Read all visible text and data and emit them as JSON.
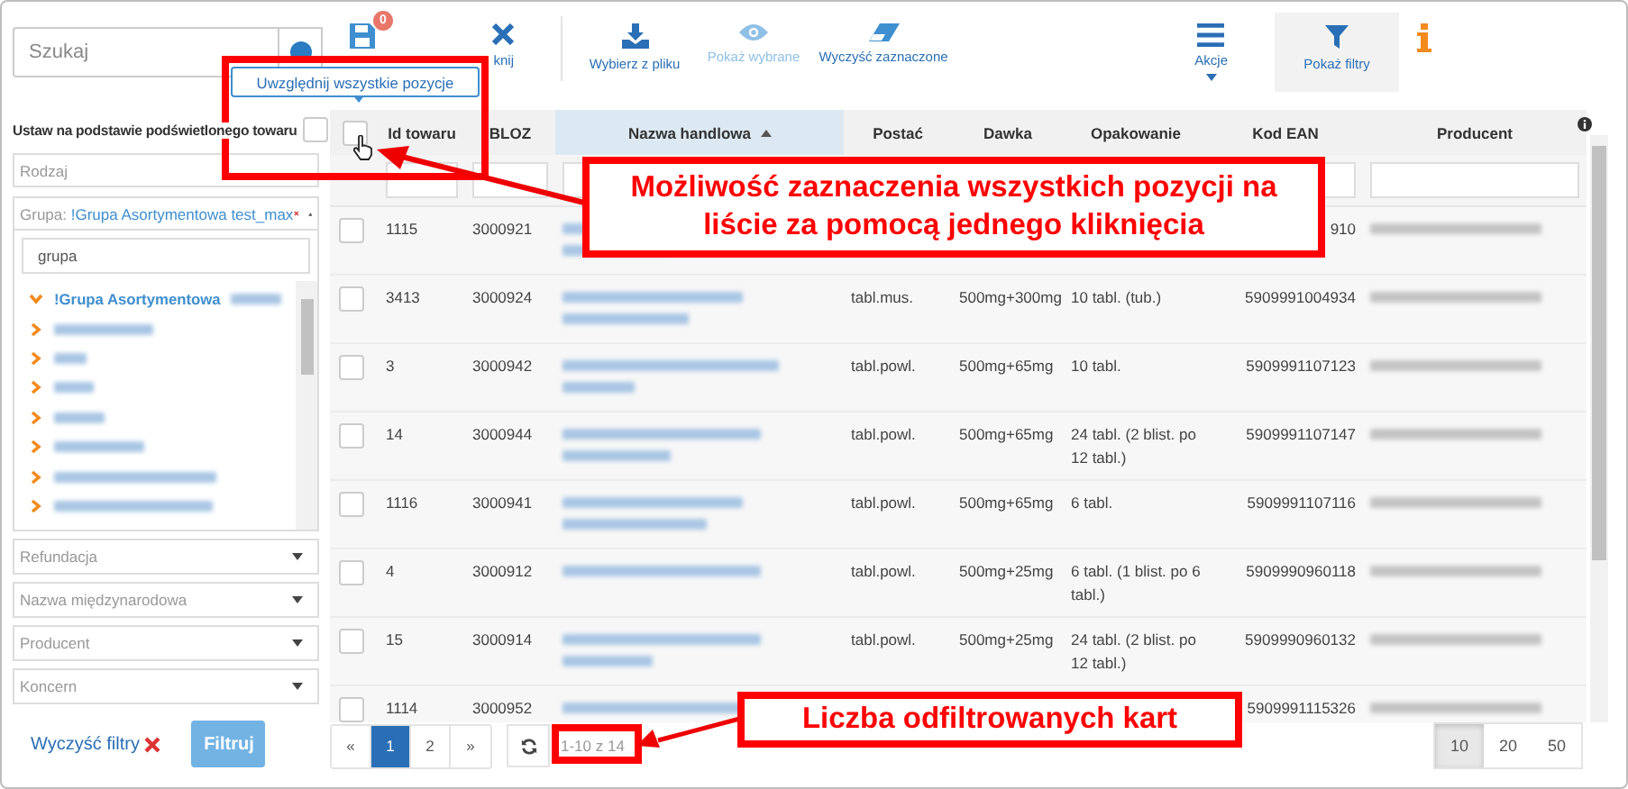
{
  "sidebar": {
    "search": {
      "placeholder": "Szukaj"
    },
    "highlight_option": {
      "label": "Ustaw na podstawie podświetlonego towaru",
      "checked": false
    },
    "kind_filter": {
      "placeholder": "Rodzaj"
    },
    "group_filter": {
      "label": "Grupa:",
      "value": "!Grupa Asortymentowa test_max"
    },
    "group_search": {
      "value": "grupa"
    },
    "tree": [
      {
        "label": "!Grupa Asortymentowa",
        "expanded": true,
        "children": [
          {
            "expanded": false
          },
          {
            "expanded": false
          },
          {
            "expanded": false
          },
          {
            "expanded": false
          },
          {
            "expanded": false
          },
          {
            "expanded": false
          },
          {
            "expanded": false
          }
        ]
      }
    ],
    "dropdowns": [
      {
        "placeholder": "Refundacja"
      },
      {
        "placeholder": "Nazwa międzynarodowa"
      },
      {
        "placeholder": "Producent"
      },
      {
        "placeholder": "Koncern"
      }
    ],
    "clear_link": "Wyczyść filtry",
    "filter_button": "Filtruj"
  },
  "toolbar": {
    "items": [
      {
        "kind": "save",
        "badge": "0"
      },
      {
        "kind": "close",
        "label": "knij"
      },
      {
        "kind": "divider"
      },
      {
        "kind": "file",
        "label": "Wybierz z pliku"
      },
      {
        "kind": "show",
        "label": "Pokaż wybrane",
        "disabled": true
      },
      {
        "kind": "clear",
        "label": "Wyczyść zaznaczone"
      },
      {
        "kind": "spacer"
      },
      {
        "kind": "actions",
        "label": "Akcje"
      },
      {
        "kind": "filters",
        "label": "Pokaż filtry",
        "selected": true
      },
      {
        "kind": "info"
      }
    ]
  },
  "tooltip": "Uwzględnij wszystkie pozycje",
  "table": {
    "select_all_checked": false,
    "columns": [
      {
        "label": "Id towaru",
        "sorted": false
      },
      {
        "label": "BLOZ",
        "sorted": false
      },
      {
        "label": "Nazwa handlowa",
        "sorted": true
      },
      {
        "label": "Postać",
        "sorted": false
      },
      {
        "label": "Dawka",
        "sorted": false
      },
      {
        "label": "Opakowanie",
        "sorted": false
      },
      {
        "label": "Kod EAN",
        "sorted": false
      },
      {
        "label": "Producent",
        "sorted": false
      }
    ],
    "rows": [
      {
        "checked": false,
        "id": "1115",
        "bloz": "3000921",
        "ean": "910"
      },
      {
        "checked": false,
        "id": "3413",
        "bloz": "3000924",
        "form": "tabl.mus.",
        "dose": "500mg+300mg",
        "pack": "10 tabl. (tub.)",
        "ean": "5909991004934"
      },
      {
        "checked": false,
        "id": "3",
        "bloz": "3000942",
        "form": "tabl.powl.",
        "dose": "500mg+65mg",
        "pack": "10 tabl.",
        "ean": "5909991107123"
      },
      {
        "checked": false,
        "id": "14",
        "bloz": "3000944",
        "form": "tabl.powl.",
        "dose": "500mg+65mg",
        "pack": "24 tabl. (2 blist. po 12 tabl.)",
        "ean": "5909991107147"
      },
      {
        "checked": false,
        "id": "1116",
        "bloz": "3000941",
        "form": "tabl.powl.",
        "dose": "500mg+65mg",
        "pack": "6 tabl.",
        "ean": "5909991107116"
      },
      {
        "checked": false,
        "id": "4",
        "bloz": "3000912",
        "form": "tabl.powl.",
        "dose": "500mg+25mg",
        "pack": "6 tabl. (1 blist. po 6 tabl.)",
        "ean": "5909990960118"
      },
      {
        "checked": false,
        "id": "15",
        "bloz": "3000914",
        "form": "tabl.powl.",
        "dose": "500mg+25mg",
        "pack": "24 tabl. (2 blist. po 12 tabl.)",
        "ean": "5909990960132"
      },
      {
        "checked": false,
        "id": "1114",
        "bloz": "3000952",
        "ean": "5909991115326"
      }
    ]
  },
  "pagination": {
    "prev": "«",
    "next": "»",
    "pages": [
      {
        "label": "1",
        "selected": true
      },
      {
        "label": "2",
        "selected": false
      }
    ],
    "range": "1-10 z 14",
    "page_sizes": [
      {
        "label": "10",
        "selected": true
      },
      {
        "label": "20",
        "selected": false
      },
      {
        "label": "50",
        "selected": false
      }
    ]
  },
  "annotations": [
    {
      "kind": "top",
      "text": "Możliwość zaznaczenia wszystkich pozycji na liście za pomocą jednego kliknięcia"
    },
    {
      "kind": "bottom",
      "text": "Liczba odfiltrowanych kart"
    }
  ]
}
